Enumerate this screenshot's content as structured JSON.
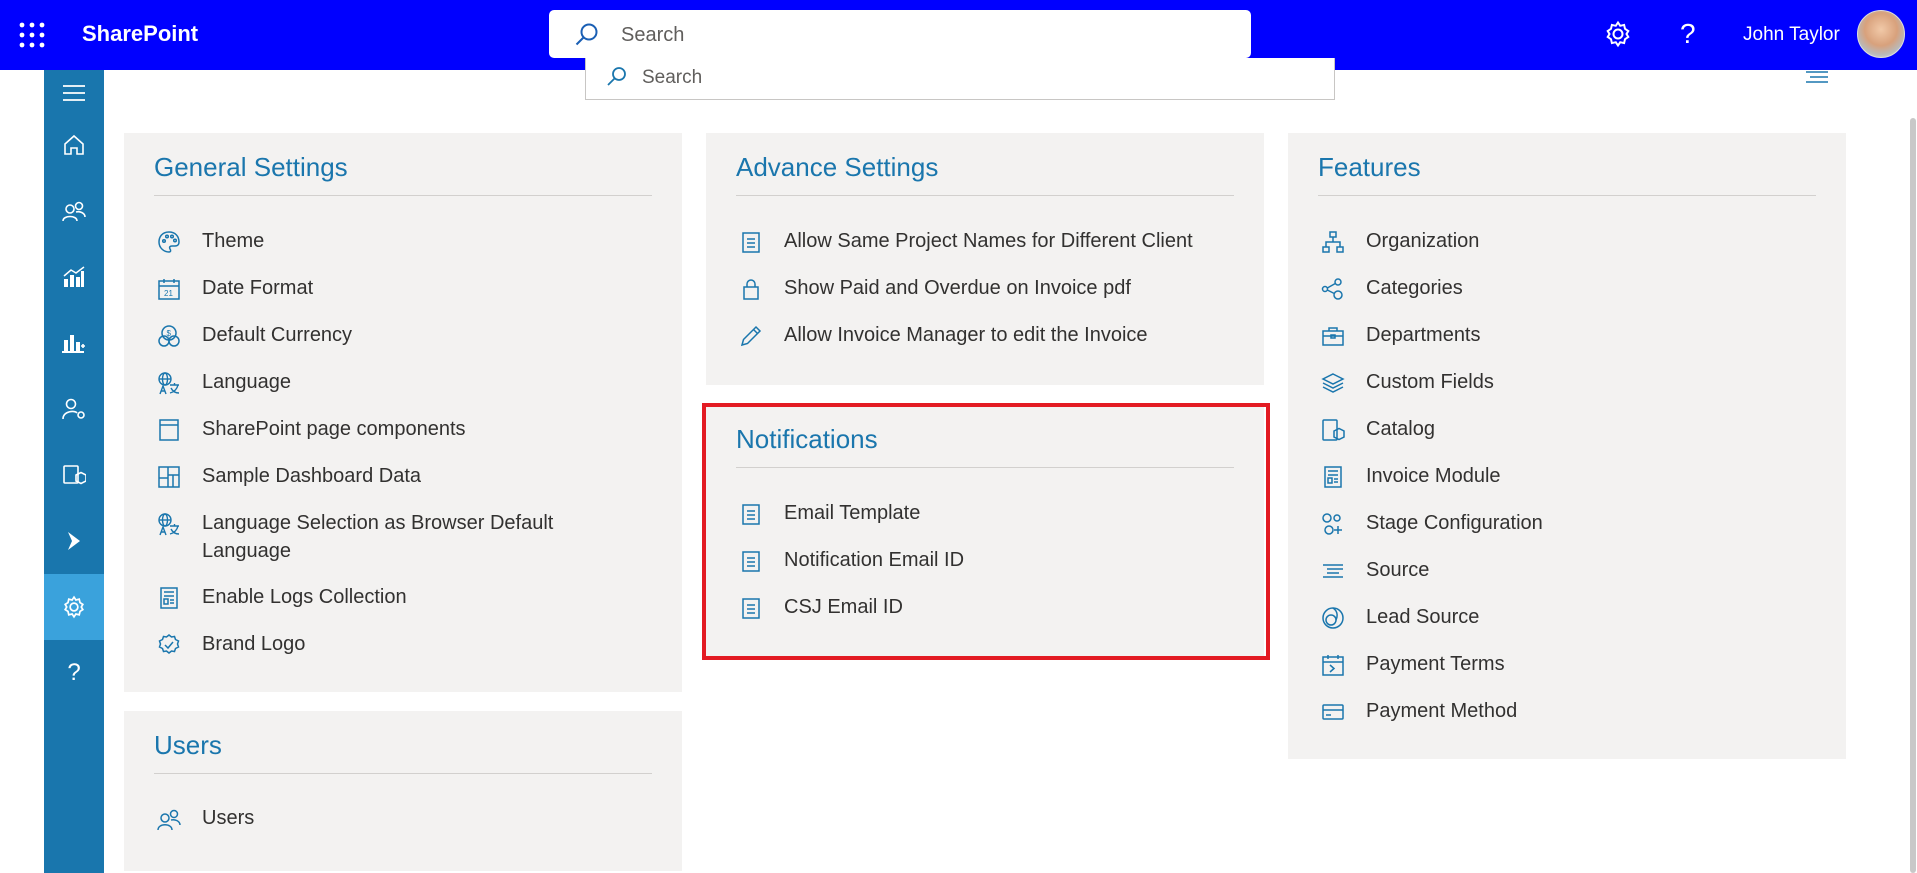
{
  "header": {
    "app_name": "SharePoint",
    "search_placeholder": "Search",
    "user_name": "John Taylor",
    "help_symbol": "?"
  },
  "subheader": {
    "search_placeholder": "Search"
  },
  "left_rail": {
    "items": [
      {
        "icon": "hamburger-icon"
      },
      {
        "icon": "home-icon"
      },
      {
        "icon": "people-icon"
      },
      {
        "icon": "chart-icon"
      },
      {
        "icon": "bar-chart-icon"
      },
      {
        "icon": "user-settings-icon"
      },
      {
        "icon": "cube-icon"
      },
      {
        "icon": "dynamics-icon"
      },
      {
        "icon": "gear-icon",
        "active": true
      },
      {
        "icon": "help-icon",
        "label": "?"
      }
    ]
  },
  "panels": {
    "general": {
      "title": "General Settings",
      "items": [
        {
          "label": "Theme",
          "icon": "palette-icon"
        },
        {
          "label": "Date Format",
          "icon": "calendar-icon"
        },
        {
          "label": "Default Currency",
          "icon": "currency-icon"
        },
        {
          "label": "Language",
          "icon": "language-icon"
        },
        {
          "label": "SharePoint page components",
          "icon": "page-icon"
        },
        {
          "label": "Sample Dashboard Data",
          "icon": "dashboard-icon"
        },
        {
          "label": "Language Selection as Browser Default Language",
          "icon": "language-icon"
        },
        {
          "label": "Enable Logs Collection",
          "icon": "log-icon"
        },
        {
          "label": "Brand Logo",
          "icon": "badge-icon"
        }
      ]
    },
    "advance": {
      "title": "Advance Settings",
      "items": [
        {
          "label": "Allow Same Project Names for Different Client",
          "icon": "document-icon"
        },
        {
          "label": "Show Paid and Overdue on Invoice pdf",
          "icon": "lock-icon"
        },
        {
          "label": "Allow Invoice Manager to edit the Invoice",
          "icon": "pencil-icon"
        }
      ]
    },
    "notifications": {
      "title": "Notifications",
      "items": [
        {
          "label": "Email Template",
          "icon": "document-icon"
        },
        {
          "label": "Notification Email ID",
          "icon": "document-icon"
        },
        {
          "label": "CSJ Email ID",
          "icon": "document-icon"
        }
      ]
    },
    "features": {
      "title": "Features",
      "items": [
        {
          "label": "Organization",
          "icon": "org-chart-icon"
        },
        {
          "label": "Categories",
          "icon": "categories-icon"
        },
        {
          "label": "Departments",
          "icon": "briefcase-icon"
        },
        {
          "label": "Custom Fields",
          "icon": "layers-icon"
        },
        {
          "label": "Catalog",
          "icon": "catalog-icon"
        },
        {
          "label": "Invoice Module",
          "icon": "invoice-icon"
        },
        {
          "label": "Stage Configuration",
          "icon": "stage-icon"
        },
        {
          "label": "Source",
          "icon": "source-lines-icon"
        },
        {
          "label": "Lead Source",
          "icon": "lead-source-icon"
        },
        {
          "label": "Payment Terms",
          "icon": "payment-terms-icon"
        },
        {
          "label": "Payment Method",
          "icon": "card-icon"
        }
      ]
    },
    "users": {
      "title": "Users",
      "items": [
        {
          "label": "Users",
          "icon": "people-icon"
        }
      ]
    }
  },
  "colors": {
    "topbar": "#0000ff",
    "rail": "#1976ad",
    "rail_active": "#3aa2dc",
    "panel_bg": "#f3f2f1",
    "title": "#1a76ad",
    "icon": "#1a76ad",
    "highlight": "#e31b23"
  }
}
